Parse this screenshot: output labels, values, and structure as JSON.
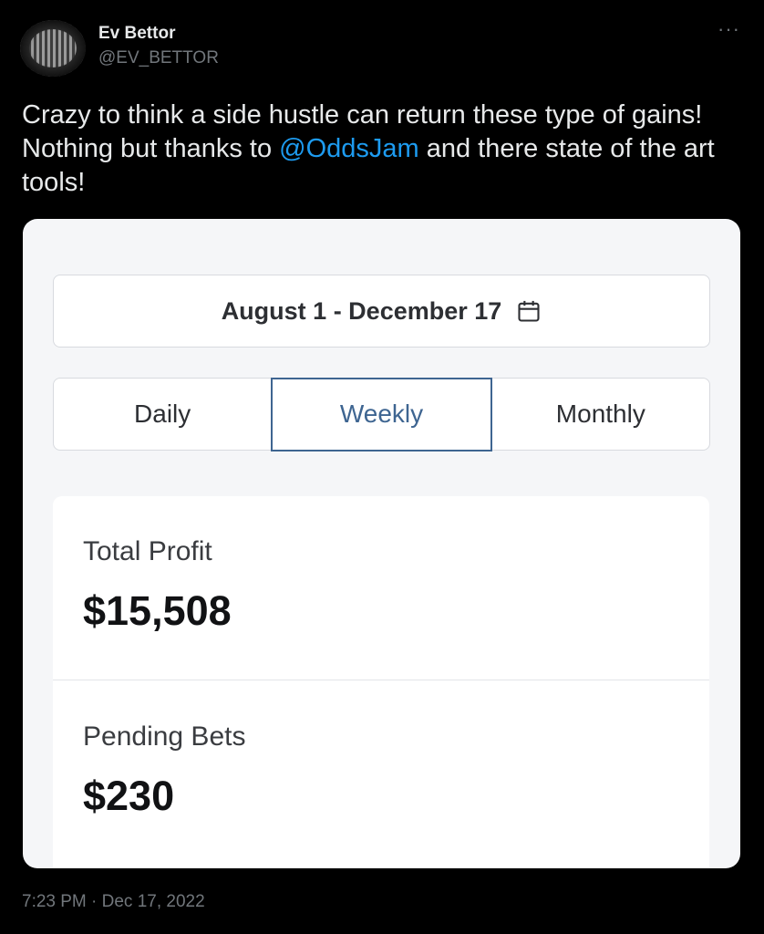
{
  "tweet": {
    "display_name": "Ev Bettor",
    "handle": "@EV_BETTOR",
    "more_label": "···",
    "text_before": "Crazy to think a side hustle can return these type of gains! Nothing but thanks to ",
    "mention": "@OddsJam",
    "text_after": " and there state of the art tools!",
    "timestamp": "7:23 PM · Dec 17, 2022"
  },
  "card": {
    "date_range": "August 1 - December 17",
    "calendar_icon": "calendar-icon",
    "periods": [
      {
        "label": "Daily",
        "selected": false
      },
      {
        "label": "Weekly",
        "selected": true
      },
      {
        "label": "Monthly",
        "selected": false
      }
    ],
    "stats": [
      {
        "label": "Total Profit",
        "value": "$15,508"
      },
      {
        "label": "Pending Bets",
        "value": "$230"
      }
    ]
  },
  "colors": {
    "background": "#000000",
    "mention": "#1d9bf0",
    "muted": "#71767b",
    "active_tab": "#3e6591"
  }
}
